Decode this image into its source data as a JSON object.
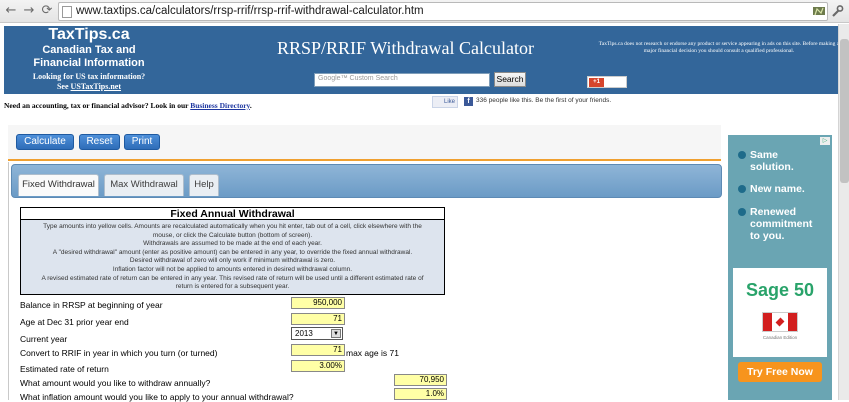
{
  "browser": {
    "url": "www.taxtips.ca/calculators/rrsp-rrif/rrsp-rrif-withdrawal-calculator.htm"
  },
  "header": {
    "site_name": "TaxTips.ca",
    "site_subtitle_1": "Canadian Tax and",
    "site_subtitle_2": "Financial Information",
    "us_prompt": "Looking for US tax information?",
    "us_see": "See ",
    "us_link": "USTaxTips.net",
    "title": "RRSP/RRIF Withdrawal Calculator",
    "disclaimer": "TaxTips.ca does not research or endorse any product   or service appearing in ads on this site. Before making a major financial decision you  should consult a qualified professional.",
    "search_label": "Google™ Custom Search",
    "search_button": "Search",
    "gplus_label": "+1"
  },
  "directory": {
    "text": "Need an accounting, tax or financial advisor? Look in our ",
    "link": "Business Directory",
    "end": "."
  },
  "facebook": {
    "like_label": "Like",
    "f": "f",
    "text": "336 people like this. Be the first of your friends."
  },
  "toolbar": {
    "calculate": "Calculate",
    "reset": "Reset",
    "print": "Print"
  },
  "tabs": [
    {
      "label": "Fixed Withdrawal",
      "active": true
    },
    {
      "label": "Max Withdrawal",
      "active": false
    },
    {
      "label": "Help",
      "active": false
    }
  ],
  "form": {
    "title": "Fixed Annual Withdrawal",
    "notes": [
      "Type amounts into yellow cells. Amounts are recalculated automatically when you hit enter, tab out of a cell, click elsewhere with the",
      "mouse, or click the Calculate button (bottom of screen).",
      "Withdrawals are assumed to be made at the end of each year.",
      "A \"desired withdrawal\" amount (enter as positive amount) can be entered in any year, to override the fixed annual withdrawal.",
      "Desired withdrawal of zero will only work if minimum withdrawal is zero.",
      "Inflation factor will not be applied to amounts entered in desired withdrawal column.",
      "A revised estimated rate of return can be entered in any year.  This revised rate of return will be used until a different estimated rate of",
      "return is entered for a subsequent year."
    ],
    "rows": [
      {
        "label": "Balance in RRSP at beginning of year",
        "value": "950,000"
      },
      {
        "label": "Age at Dec 31 prior year end",
        "value": "71"
      },
      {
        "label": "Current year",
        "value": "2013"
      },
      {
        "label": "Convert to RRIF in year in which you turn (or turned)",
        "value": "71",
        "suffix": "max age is 71"
      },
      {
        "label": "Estimated rate of return",
        "value": "3.00%"
      },
      {
        "label": "What amount would you like to withdraw annually?",
        "value": "70,950"
      },
      {
        "label": "What inflation amount would you like to apply to your annual withdrawal?",
        "value": "1.0%"
      }
    ]
  },
  "ad": {
    "badge": "▷",
    "bullets": [
      {
        "line1": "Same",
        "line2": "solution."
      },
      {
        "line1": "New name.",
        "line2": ""
      },
      {
        "line1": "Renewed",
        "line2": "commitment",
        "line3": "to you."
      }
    ],
    "brand": "Sage 50",
    "edition": "Canadian Edition",
    "cta": "Try Free Now",
    "colors": {
      "background": "#6aa5b3",
      "cta": "#f7941d",
      "brand": "#29a36a"
    }
  },
  "colors": {
    "banner": "#33669a",
    "input_cell": "#ffffa6",
    "button": "#3a7bc8",
    "toolbar_accent": "#f0a030"
  }
}
